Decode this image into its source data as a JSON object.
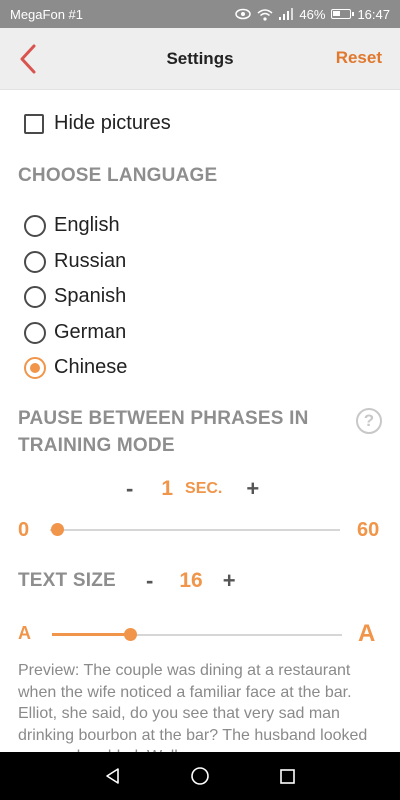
{
  "status_bar": {
    "carrier": "MegaFon #1",
    "battery_percent": "46%",
    "battery_level": 0.46,
    "time": "16:47",
    "icons": [
      "eye-icon",
      "wifi-icon",
      "signal-icon",
      "battery-icon"
    ]
  },
  "app_bar": {
    "title": "Settings",
    "reset_label": "Reset",
    "back_icon": "chevron-left-icon"
  },
  "settings": {
    "hide_pictures": {
      "label": "Hide pictures",
      "checked": false
    },
    "language": {
      "title": "CHOOSE LANGUAGE",
      "options": [
        "English",
        "Russian",
        "Spanish",
        "German",
        "Chinese"
      ],
      "selected": "Chinese"
    },
    "pause": {
      "title_line1": "PAUSE BETWEEN PHRASES IN",
      "title_line2": "TRAINING MODE",
      "minus": "-",
      "plus": "+",
      "value": "1",
      "unit": "SEC.",
      "min": "0",
      "max": "60",
      "numeric_value": 1
    },
    "text_size": {
      "title": "TEXT SIZE",
      "minus": "-",
      "plus": "+",
      "value": "16",
      "min_label": "A",
      "max_label": "A",
      "level": 0.27
    },
    "preview_text": "Preview: The couple was dining at a restaurant when the wife noticed a familiar face at the bar. Elliot, she said, do you see that very sad man drinking bourbon at the bar? The husband looked over and nodded. Well,"
  },
  "colors": {
    "accent": "#f0954a",
    "reset_text": "#e0782e",
    "back_arrow": "#d9534f",
    "section_title": "#8e8e8e",
    "status_bar": "#8c8c8c",
    "nav_bar": "#000000"
  },
  "nav_bar": {
    "icons": [
      "back-triangle-icon",
      "home-circle-icon",
      "recents-square-icon"
    ]
  }
}
